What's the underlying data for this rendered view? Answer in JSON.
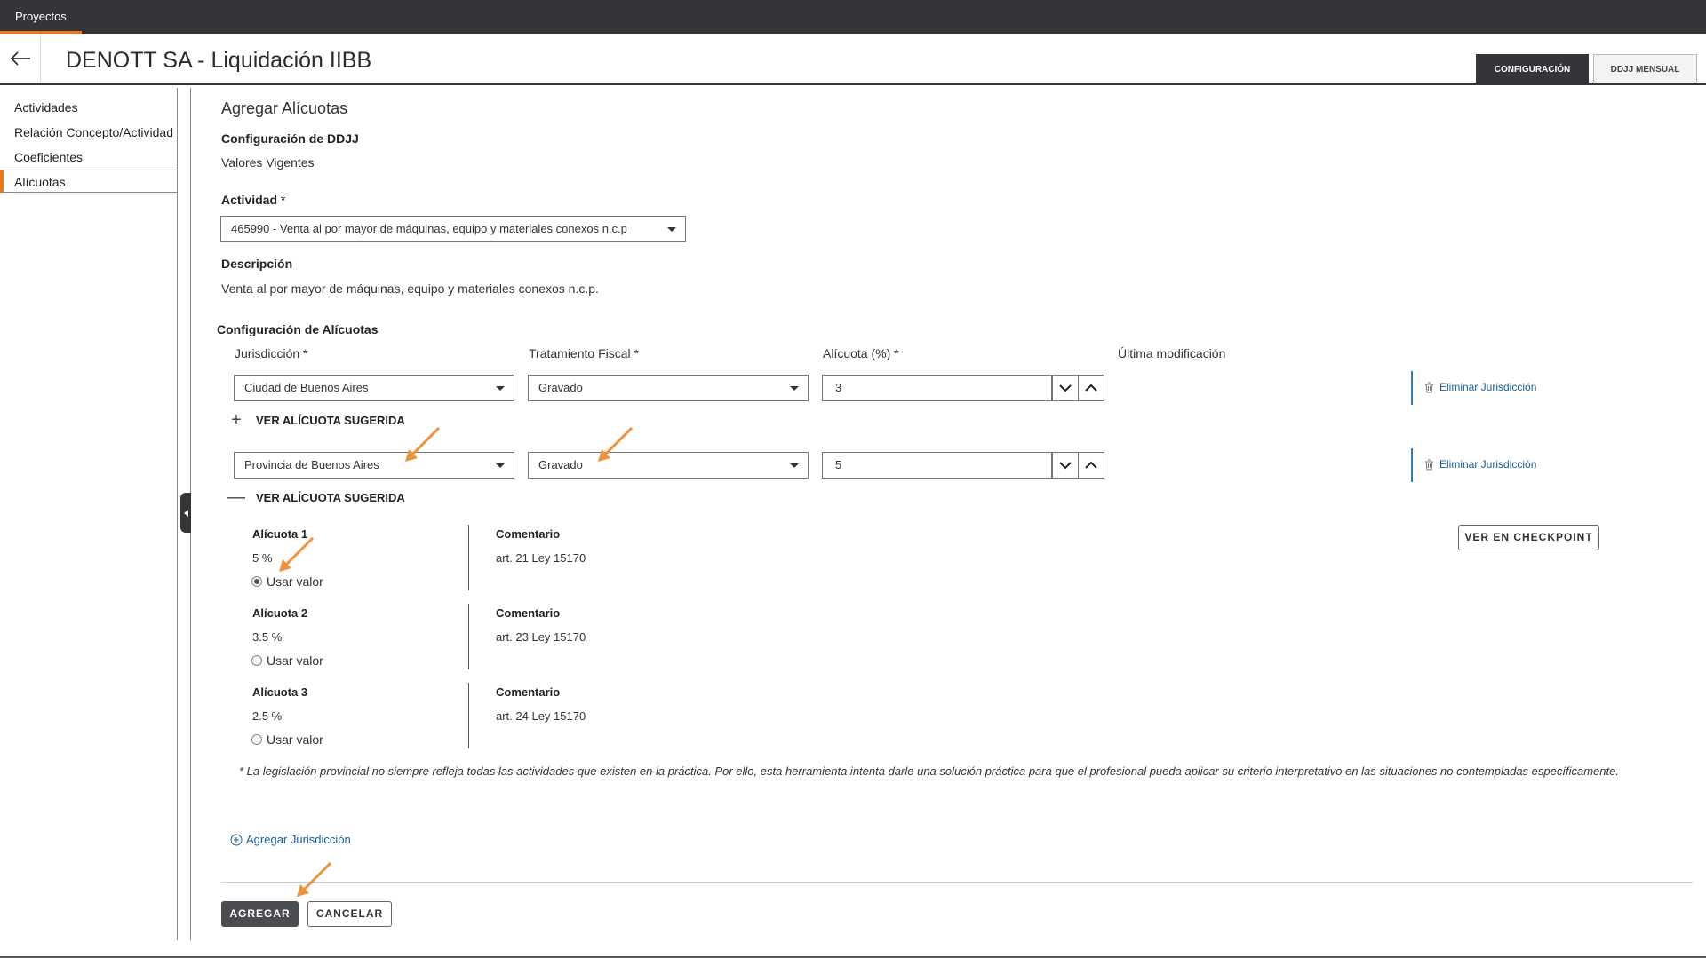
{
  "topnav": {
    "tab": "Proyectos"
  },
  "header": {
    "title": "DENOTT SA - Liquidación IIBB",
    "tabs": [
      {
        "label": "CONFIGURACIÓN",
        "active": true
      },
      {
        "label": "DDJJ MENSUAL",
        "active": false
      }
    ]
  },
  "sidebar": {
    "items": [
      {
        "label": "Actividades"
      },
      {
        "label": "Relación Concepto/Actividad"
      },
      {
        "label": "Coeficientes"
      },
      {
        "label": "Alícuotas",
        "active": true
      }
    ]
  },
  "form": {
    "title": "Agregar Alícuotas",
    "config_label": "Configuración de DDJJ",
    "config_value": "Valores Vigentes",
    "actividad_label": "Actividad",
    "required_mark": "*",
    "actividad_value": "465990 - Venta al por mayor de máquinas, equipo y materiales conexos n.c.p",
    "descripcion_label": "Descripción",
    "descripcion_value": "Venta al por mayor de máquinas, equipo y materiales conexos n.c.p.",
    "alicuotas_title": "Configuración de Alícuotas",
    "columns": {
      "jurisdiccion": "Jurisdicción *",
      "tratamiento": "Tratamiento Fiscal *",
      "alicuota": "Alícuota (%) *",
      "ultima": "Última modificación"
    },
    "rows": [
      {
        "jurisdiccion": "Ciudad de Buenos Aires",
        "tratamiento": "Gravado",
        "alicuota": "3",
        "delete_label": "Eliminar Jurisdicción",
        "toggle_sign": "+",
        "toggle_label": "VER ALÍCUOTA SUGERIDA"
      },
      {
        "jurisdiccion": "Provincia de Buenos Aires",
        "tratamiento": "Gravado",
        "alicuota": "5",
        "delete_label": "Eliminar Jurisdicción",
        "toggle_sign": "—",
        "toggle_label": "VER ALÍCUOTA SUGERIDA"
      }
    ],
    "sugeridas": [
      {
        "title": "Alícuota 1",
        "value": "5 %",
        "use_label": "Usar valor",
        "selected": true,
        "comment_label": "Comentario",
        "comment": "art. 21 Ley 15170"
      },
      {
        "title": "Alícuota 2",
        "value": "3.5 %",
        "use_label": "Usar valor",
        "selected": false,
        "comment_label": "Comentario",
        "comment": "art. 23 Ley 15170"
      },
      {
        "title": "Alícuota 3",
        "value": "2.5 %",
        "use_label": "Usar valor",
        "selected": false,
        "comment_label": "Comentario",
        "comment": "art. 24 Ley 15170"
      }
    ],
    "checkpoint_button": "VER EN CHECKPOINT",
    "note": "* La legislación provincial no siempre refleja todas las actividades que existen en la práctica. Por ello, esta herramienta intenta darle una solución práctica para que el profesional pueda aplicar su criterio interpretativo en las situaciones no contempladas específicamente.",
    "add_jurisdiccion": "Agregar Jurisdicción",
    "submit": "AGREGAR",
    "cancel": "CANCELAR"
  },
  "colors": {
    "accent": "#e8781a",
    "dark": "#333538",
    "link": "#1a5e9a"
  }
}
